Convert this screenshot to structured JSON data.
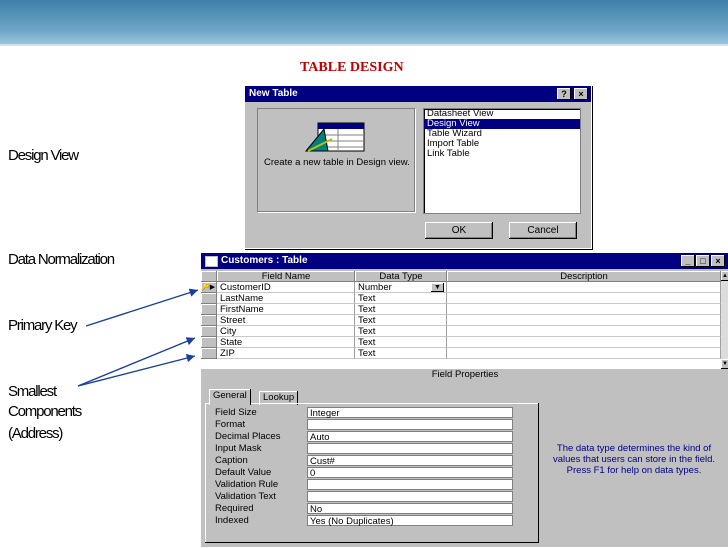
{
  "slide": {
    "title": "TABLE DESIGN",
    "notes": {
      "design_view": "Design View",
      "data_normalization": "Data Normalization",
      "primary_key": "Primary Key",
      "smallest_line1": "Smallest",
      "smallest_line2": "Components",
      "smallest_line3": "(Address)"
    }
  },
  "new_table_dialog": {
    "title": "New Table",
    "help_btn": "?",
    "close_btn": "×",
    "description": "Create a new table in Design view.",
    "options": [
      "Datasheet View",
      "Design View",
      "Table Wizard",
      "Import Table",
      "Link Table"
    ],
    "selected_option": "Design View",
    "ok_label": "OK",
    "cancel_label": "Cancel"
  },
  "customers_window": {
    "title": "Customers : Table",
    "columns": {
      "field_name": "Field Name",
      "data_type": "Data Type",
      "description": "Description"
    },
    "rows": [
      {
        "field": "CustomerID",
        "type": "Number"
      },
      {
        "field": "LastName",
        "type": "Text"
      },
      {
        "field": "FirstName",
        "type": "Text"
      },
      {
        "field": "Street",
        "type": "Text"
      },
      {
        "field": "City",
        "type": "Text"
      },
      {
        "field": "State",
        "type": "Text"
      },
      {
        "field": "ZIP",
        "type": "Text"
      }
    ],
    "field_properties_label": "Field Properties",
    "tabs": {
      "general": "General",
      "lookup": "Lookup"
    },
    "properties": [
      {
        "label": "Field Size",
        "value": "Integer"
      },
      {
        "label": "Format",
        "value": ""
      },
      {
        "label": "Decimal Places",
        "value": "Auto"
      },
      {
        "label": "Input Mask",
        "value": ""
      },
      {
        "label": "Caption",
        "value": "Cust#"
      },
      {
        "label": "Default Value",
        "value": "0"
      },
      {
        "label": "Validation Rule",
        "value": ""
      },
      {
        "label": "Validation Text",
        "value": ""
      },
      {
        "label": "Required",
        "value": "No"
      },
      {
        "label": "Indexed",
        "value": "Yes (No Duplicates)"
      }
    ],
    "help_text": "The data type determines the kind of values that users can store in the field. Press F1 for help on data types."
  }
}
